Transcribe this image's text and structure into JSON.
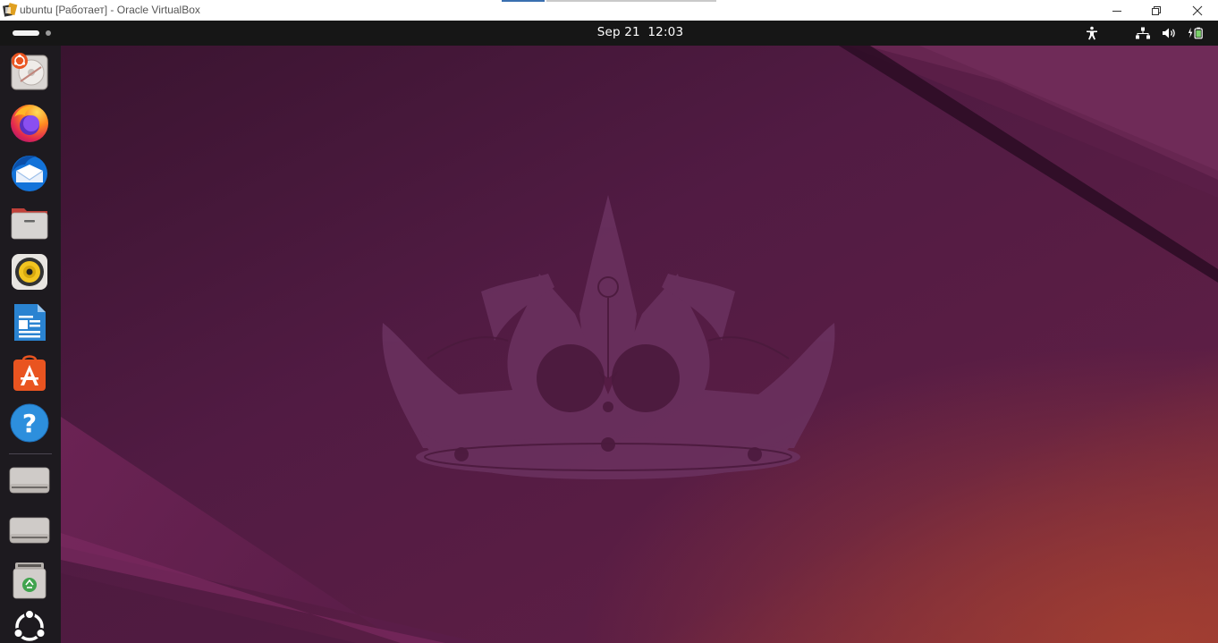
{
  "window": {
    "title": "ubuntu [Работает] - Oracle VirtualBox",
    "minimize_icon": "minimize-icon",
    "restore_icon": "restore-icon",
    "close_icon": "close-icon"
  },
  "topbar": {
    "activities_icon": "activities-indicator",
    "date": "Sep 21",
    "time": "12:03",
    "tray": [
      "accessibility-icon",
      "network-wired-icon",
      "volume-icon",
      "battery-charging-icon"
    ]
  },
  "dock": {
    "items": [
      {
        "name": "install-ubuntu",
        "icon": "installer-disk-icon"
      },
      {
        "name": "firefox",
        "icon": "firefox-icon"
      },
      {
        "name": "thunderbird",
        "icon": "thunderbird-icon"
      },
      {
        "name": "files",
        "icon": "files-folder-icon"
      },
      {
        "name": "rhythmbox",
        "icon": "rhythmbox-speaker-icon"
      },
      {
        "name": "libreoffice-writer",
        "icon": "writer-document-icon"
      },
      {
        "name": "app-center",
        "icon": "app-center-icon"
      },
      {
        "name": "help",
        "icon": "help-icon"
      },
      {
        "name": "drive-1",
        "icon": "drive-icon"
      },
      {
        "name": "drive-2",
        "icon": "drive-icon"
      },
      {
        "name": "trash",
        "icon": "trash-icon"
      },
      {
        "name": "show-apps",
        "icon": "ubuntu-logo-icon"
      }
    ]
  },
  "colors": {
    "desktop_base": "#4b1a3d",
    "topbar_bg": "#161616",
    "dock_bg": "#1d1a1f",
    "accent_orange": "#e95420"
  }
}
